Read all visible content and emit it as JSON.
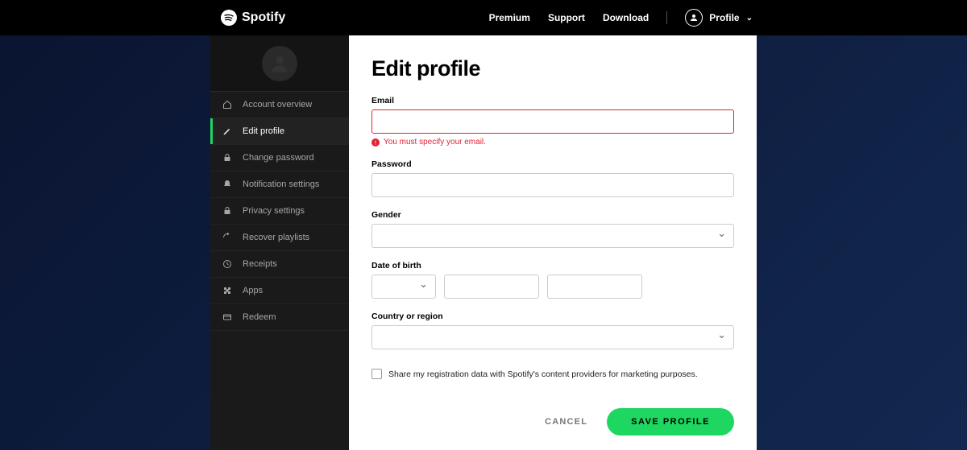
{
  "brand": "Spotify",
  "topnav": {
    "premium": "Premium",
    "support": "Support",
    "download": "Download",
    "profile": "Profile"
  },
  "sidebar": {
    "items": [
      {
        "label": "Account overview",
        "icon": "home"
      },
      {
        "label": "Edit profile",
        "icon": "pencil"
      },
      {
        "label": "Change password",
        "icon": "lock"
      },
      {
        "label": "Notification settings",
        "icon": "bell"
      },
      {
        "label": "Privacy settings",
        "icon": "lock"
      },
      {
        "label": "Recover playlists",
        "icon": "refresh"
      },
      {
        "label": "Receipts",
        "icon": "clock"
      },
      {
        "label": "Apps",
        "icon": "puzzle"
      },
      {
        "label": "Redeem",
        "icon": "card"
      }
    ],
    "activeIndex": 1
  },
  "page": {
    "title": "Edit profile",
    "email": {
      "label": "Email",
      "value": "",
      "error": "You must specify your email."
    },
    "password": {
      "label": "Password",
      "value": ""
    },
    "gender": {
      "label": "Gender",
      "value": ""
    },
    "dob": {
      "label": "Date of birth",
      "month": "",
      "day": "",
      "year": ""
    },
    "country": {
      "label": "Country or region",
      "value": ""
    },
    "marketing": {
      "label": "Share my registration data with Spotify's content providers for marketing purposes.",
      "checked": false
    },
    "buttons": {
      "cancel": "CANCEL",
      "save": "SAVE PROFILE"
    }
  }
}
